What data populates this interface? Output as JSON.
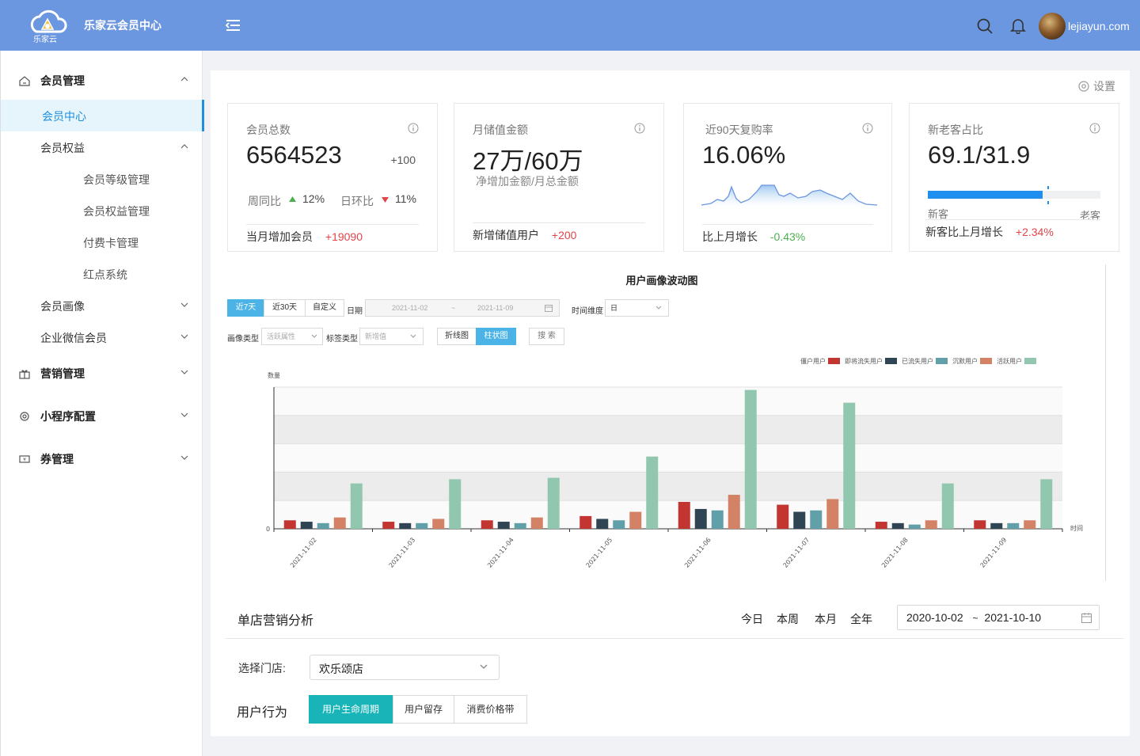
{
  "header": {
    "logo_text": "乐家云",
    "brand": "乐家云会员中心",
    "username": "lejiayun.com"
  },
  "sidebar": {
    "groups": [
      {
        "label": "会员管理",
        "icon": "home-icon"
      },
      {
        "label": "营销管理",
        "icon": "gift-icon"
      },
      {
        "label": "小程序配置",
        "icon": "gear-icon"
      },
      {
        "label": "券管理",
        "icon": "ticket-icon"
      }
    ],
    "items": {
      "member_center": "会员中心",
      "member_rights": "会员权益",
      "level_mgmt": "会员等级管理",
      "rights_mgmt": "会员权益管理",
      "paycard_mgmt": "付费卡管理",
      "redpoint": "红点系统",
      "member_portrait": "会员画像",
      "wechat_member": "企业微信会员"
    }
  },
  "main": {
    "settings": "设置",
    "stats": {
      "total": {
        "title": "会员总数",
        "value": "6564523",
        "delta": "+100",
        "wow_label": "周同比",
        "wow_value": "12%",
        "dod_label": "日环比",
        "dod_value": "11%",
        "foot_label": "当月增加会员",
        "foot_value": "+19090"
      },
      "recharge": {
        "title": "月储值金额",
        "value": "27万/60万",
        "sub": "净增加金额/月总金额",
        "foot_label": "新增储值用户",
        "foot_value": "+200"
      },
      "repurchase": {
        "title": "近90天复购率",
        "value": "16.06%",
        "foot_label": "比上月增长",
        "foot_value": "-0.43%"
      },
      "ratio": {
        "title": "新老客占比",
        "value": "69.1/31.9",
        "new_label": "新客",
        "old_label": "老客",
        "new_share": 0.691,
        "foot_label": "新客比上月增长",
        "foot_value": "+2.34%"
      }
    },
    "chart_panel": {
      "title": "用户画像波动图",
      "range_buttons": [
        "近7天",
        "近30天",
        "自定义"
      ],
      "date_label": "日期",
      "date_start": "2021-11-02",
      "date_sep": "~",
      "date_end": "2021-11-09",
      "time_dim_label": "时间维度",
      "time_dim_value": "日",
      "portrait_type_label": "画像类型",
      "portrait_type_value": "活跃属性",
      "tag_type_label": "标签类型",
      "tag_type_value": "新增值",
      "view_buttons": [
        "折线图",
        "柱状图"
      ],
      "search_button": "搜 索"
    }
  },
  "chart_data": {
    "type": "bar",
    "ylabel": "数量",
    "xlabel": "时间",
    "y_tick_zero": "0",
    "categories": [
      "2021-11-02",
      "2021-11-03",
      "2021-11-04",
      "2021-11-05",
      "2021-11-06",
      "2021-11-07",
      "2021-11-08",
      "2021-11-09"
    ],
    "ylim": [
      0,
      100
    ],
    "grid": "horizontal bands",
    "legend_position": "top-right",
    "series": [
      {
        "name": "僵户用户",
        "color": "#c23531",
        "values": [
          6,
          5,
          6,
          9,
          19,
          17,
          5,
          6
        ]
      },
      {
        "name": "即将流失用户",
        "color": "#2f4554",
        "values": [
          5,
          4,
          5,
          7,
          14,
          12,
          4,
          4
        ]
      },
      {
        "name": "已流失用户",
        "color": "#61a0a8",
        "values": [
          4,
          4,
          4,
          6,
          13,
          13,
          3,
          4
        ]
      },
      {
        "name": "沉默用户",
        "color": "#d48265",
        "values": [
          8,
          7,
          8,
          12,
          24,
          21,
          6,
          6
        ]
      },
      {
        "name": "活跃用户",
        "color": "#91c7ae",
        "values": [
          32,
          35,
          36,
          51,
          98,
          89,
          32,
          35
        ]
      }
    ]
  },
  "store_section": {
    "title": "单店营销分析",
    "ranges": [
      "今日",
      "本周",
      "本月",
      "全年"
    ],
    "date_start": "2020-10-02",
    "date_sep": "~",
    "date_end": "2021-10-10",
    "store_label": "选择门店:",
    "store_value": "欢乐颂店",
    "behavior_label": "用户行为",
    "behavior_tabs": [
      "用户生命周期",
      "用户留存",
      "消费价格带"
    ]
  }
}
